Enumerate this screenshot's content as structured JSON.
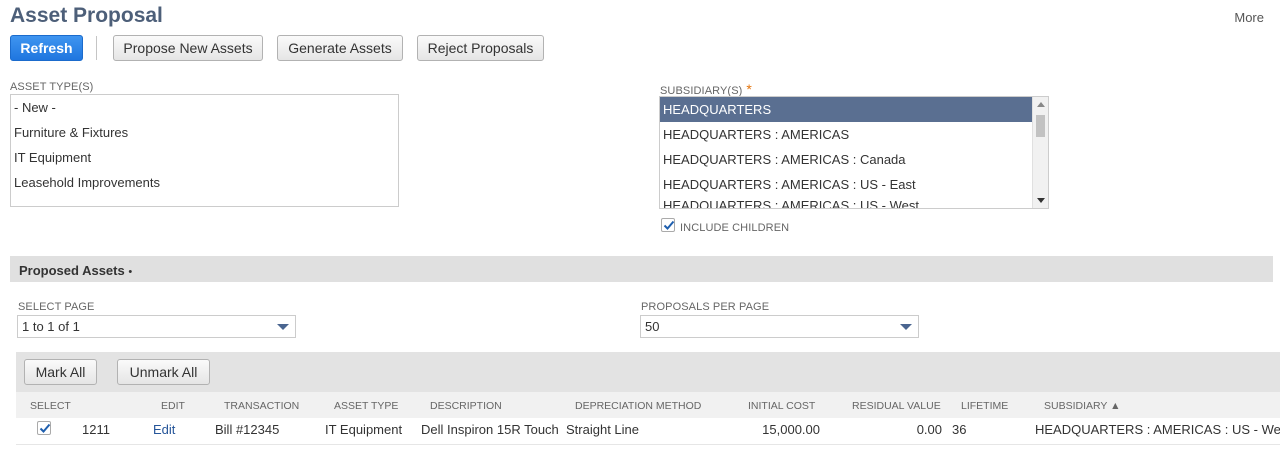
{
  "header": {
    "title": "Asset Proposal",
    "more_label": "More"
  },
  "toolbar": {
    "refresh_label": "Refresh",
    "propose_label": "Propose New Assets",
    "generate_label": "Generate Assets",
    "reject_label": "Reject Proposals"
  },
  "asset_types": {
    "label": "ASSET TYPE(S)",
    "options": [
      "- New -",
      "Furniture & Fixtures",
      "IT Equipment",
      "Leasehold Improvements"
    ]
  },
  "subsidiaries": {
    "label": "SUBSIDIARY(S)",
    "required_mark": "*",
    "options": [
      "HEADQUARTERS",
      "HEADQUARTERS : AMERICAS",
      "HEADQUARTERS : AMERICAS : Canada",
      "HEADQUARTERS : AMERICAS : US - East",
      "HEADQUARTERS : AMERICAS : US - West"
    ],
    "selected_index": 0,
    "include_children_label": "INCLUDE CHILDREN",
    "include_children_checked": true
  },
  "proposed_assets": {
    "title": "Proposed Assets",
    "title_marker": "•",
    "select_page_label": "SELECT PAGE",
    "select_page_value": "1 to 1 of 1",
    "per_page_label": "PROPOSALS PER PAGE",
    "per_page_value": "50",
    "mark_all_label": "Mark All",
    "unmark_all_label": "Unmark All",
    "columns": {
      "select": "SELECT",
      "edit": "EDIT",
      "transaction": "TRANSACTION",
      "asset_type": "ASSET TYPE",
      "description": "DESCRIPTION",
      "depreciation_method": "DEPRECIATION METHOD",
      "initial_cost": "INITIAL COST",
      "residual_value": "RESIDUAL VALUE",
      "lifetime": "LIFETIME",
      "subsidiary": "SUBSIDIARY ▲"
    },
    "rows": [
      {
        "selected": true,
        "id": "1211",
        "edit": "Edit",
        "transaction": "Bill #12345",
        "asset_type": "IT Equipment",
        "description": "Dell Inspiron 15R Touch",
        "depreciation_method": "Straight Line",
        "initial_cost": "15,000.00",
        "residual_value": "0.00",
        "lifetime": "36",
        "subsidiary": "HEADQUARTERS : AMERICAS : US - West"
      }
    ]
  },
  "colors": {
    "accent_blue": "#1f76df",
    "title_color": "#4d5f79",
    "selected_row": "#5a6f91",
    "link": "#255599",
    "required": "#e4730b"
  }
}
